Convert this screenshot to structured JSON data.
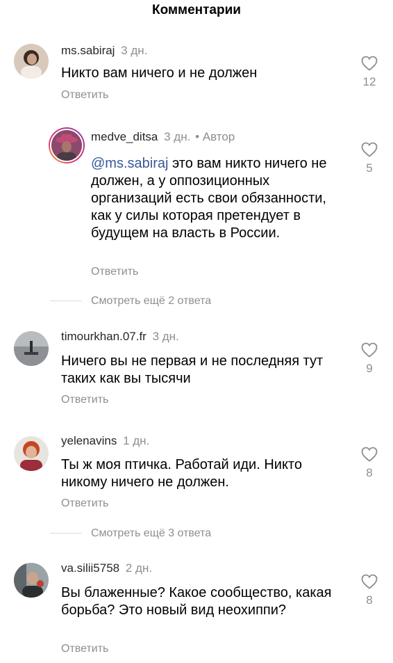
{
  "header": {
    "title": "Комментарии"
  },
  "comments": [
    {
      "username": "ms.sabiraj",
      "time": "3 дн.",
      "text": "Никто вам ничего и не должен",
      "reply_label": "Ответить",
      "likes": "12"
    },
    {
      "username": "medve_ditsa",
      "time": "3 дн.",
      "dot": "•",
      "author_label": "Автор",
      "mention": "@ms.sabiraj",
      "text": " это вам никто ничего не должен, а у оппозиционных организаций есть свои обязанности, как у силы которая претендует в будущем на власть в России.",
      "reply_label": "Ответить",
      "likes": "5",
      "more_replies": "Смотреть ещё 2 ответа"
    },
    {
      "username": "timourkhan.07.fr",
      "time": "3 дн.",
      "text": "Ничего вы не первая и не последняя тут таких как вы тысячи",
      "reply_label": "Ответить",
      "likes": "9"
    },
    {
      "username": "yelenavins",
      "time": "1 дн.",
      "text": "Ты ж моя птичка. Работай иди. Никто никому ничего не должен.",
      "reply_label": "Ответить",
      "likes": "8",
      "more_replies": "Смотреть ещё 3 ответа"
    },
    {
      "username": "va.silii5758",
      "time": "2 дн.",
      "text": "Вы блаженные? Какое сообщество, какая борьба? Это новый вид неохиппи?",
      "reply_label": "Ответить",
      "likes": "8"
    }
  ],
  "icons": {
    "like": "heart-outline-icon"
  },
  "colors": {
    "secondary_text": "#8e8e8e",
    "mention": "#385898",
    "story_ring": "#e1306c"
  }
}
